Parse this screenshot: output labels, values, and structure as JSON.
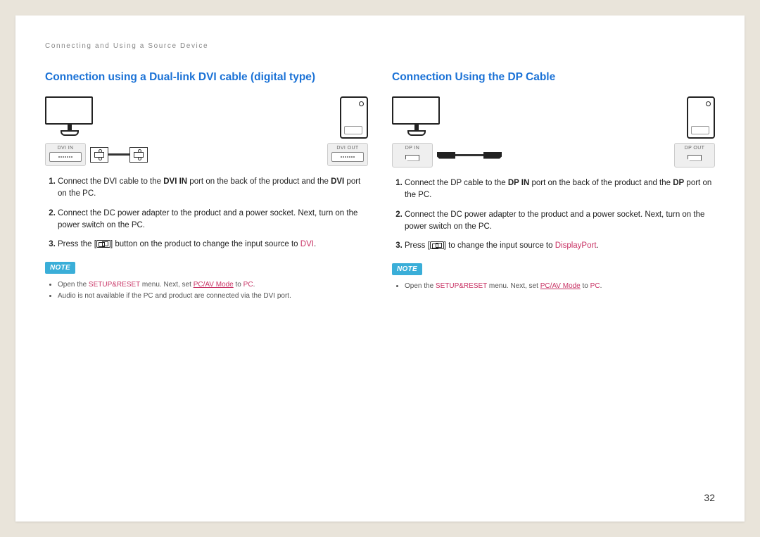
{
  "chapter": "Connecting and Using a Source Device",
  "page_number": "32",
  "left": {
    "title": "Connection using a Dual-link DVI cable (digital type)",
    "port_in": "DVI IN",
    "port_out": "DVI OUT",
    "step1_a": "Connect the DVI cable to the ",
    "step1_b": "DVI IN",
    "step1_c": " port on the back of the product and the ",
    "step1_d": "DVI",
    "step1_e": " port on the PC.",
    "step2": "Connect the DC power adapter to the product and a power socket. Next, turn on the power switch on the PC.",
    "step3_a": "Press the [",
    "step3_b": "] button on the product to change the input source to ",
    "step3_src": "DVI",
    "step3_end": ".",
    "note_label": "NOTE",
    "note1_a": "Open the ",
    "note1_b": "SETUP&RESET",
    "note1_c": " menu. Next, set ",
    "note1_d": "PC/AV Mode",
    "note1_e": " to ",
    "note1_f": "PC",
    "note1_g": ".",
    "note2": "Audio is not available if the PC and product are connected via the DVI port."
  },
  "right": {
    "title": "Connection Using the DP Cable",
    "port_in": "DP IN",
    "port_out": "DP OUT",
    "step1_a": "Connect the DP cable to the ",
    "step1_b": "DP IN",
    "step1_c": " port on the back of the product and the ",
    "step1_d": "DP",
    "step1_e": " port on the PC.",
    "step2": "Connect the DC power adapter to the product and a power socket. Next, turn on the power switch on the PC.",
    "step3_a": "Press [",
    "step3_b": "] to change the input source to ",
    "step3_src": "DisplayPort",
    "step3_end": ".",
    "note_label": "NOTE",
    "note1_a": "Open the ",
    "note1_b": "SETUP&RESET",
    "note1_c": " menu. Next, set ",
    "note1_d": "PC/AV Mode",
    "note1_e": " to ",
    "note1_f": "PC",
    "note1_g": "."
  }
}
